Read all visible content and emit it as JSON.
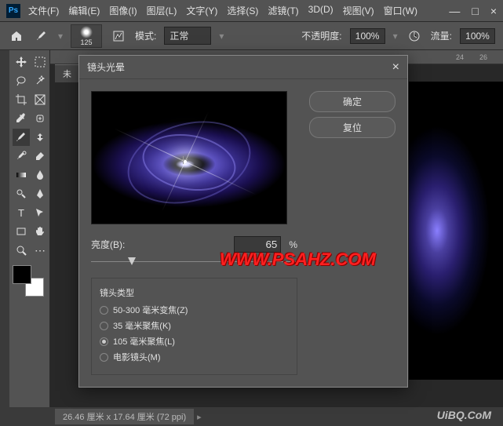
{
  "app": {
    "logo": "Ps"
  },
  "menu": {
    "file": "文件(F)",
    "edit": "编辑(E)",
    "image": "图像(I)",
    "layer": "图层(L)",
    "type": "文字(Y)",
    "select": "选择(S)",
    "filter": "滤镜(T)",
    "threeD": "3D(D)",
    "view": "视图(V)",
    "window": "窗口(W)"
  },
  "wctrl": {
    "min": "—",
    "max": "□",
    "close": "×"
  },
  "optbar": {
    "brush_size": "125",
    "mode_label": "模式:",
    "mode_value": "正常",
    "opacity_label": "不透明度:",
    "opacity_value": "100%",
    "flow_label": "流量:",
    "flow_value": "100%"
  },
  "ruler": {
    "t1": "24",
    "t2": "26"
  },
  "tab": {
    "label": "未"
  },
  "dialog": {
    "title": "镜头光晕",
    "ok": "确定",
    "reset": "复位",
    "brightness_label": "亮度(B):",
    "brightness_value": "65",
    "brightness_pct": "%",
    "lens_group": "镜头类型",
    "lens": [
      {
        "label": "50-300 毫米变焦(Z)",
        "checked": false
      },
      {
        "label": "35 毫米聚焦(K)",
        "checked": false
      },
      {
        "label": "105 毫米聚焦(L)",
        "checked": true
      },
      {
        "label": "电影镜头(M)",
        "checked": false
      }
    ]
  },
  "status": {
    "doc": "26.46 厘米 x 17.64 厘米 (72 ppi)"
  },
  "watermark": {
    "w1": "WWW.PSAHZ.COM",
    "w2": "UiBQ.CoM"
  },
  "slider_pos": "18%"
}
